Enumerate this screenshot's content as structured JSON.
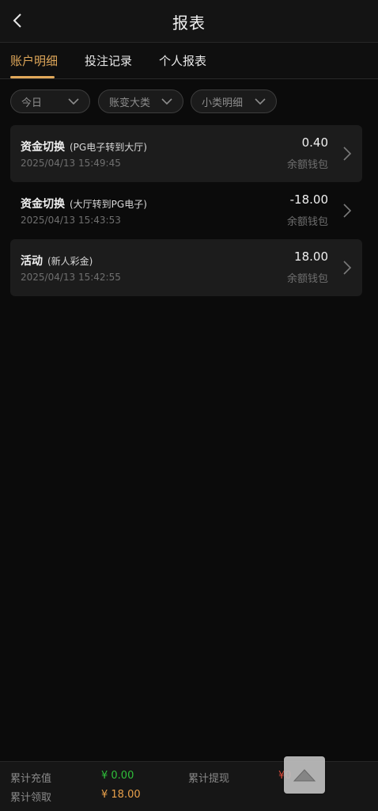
{
  "header": {
    "title": "报表",
    "back_icon": "chevron-left-icon"
  },
  "tabs": [
    {
      "label": "账户明细",
      "active": true
    },
    {
      "label": "投注记录",
      "active": false
    },
    {
      "label": "个人报表",
      "active": false
    }
  ],
  "filters": [
    {
      "label": "今日"
    },
    {
      "label": "账变大类"
    },
    {
      "label": "小类明细"
    }
  ],
  "records": [
    {
      "title": "资金切换",
      "subtitle": "(PG电子转到大厅)",
      "time": "2025/04/13 15:49:45",
      "amount": "0.40",
      "wallet": "余额钱包"
    },
    {
      "title": "资金切换",
      "subtitle": "(大厅转到PG电子)",
      "time": "2025/04/13 15:43:53",
      "amount": "-18.00",
      "wallet": "余额钱包"
    },
    {
      "title": "活动",
      "subtitle": "(新人彩金)",
      "time": "2025/04/13 15:42:55",
      "amount": "18.00",
      "wallet": "余额钱包"
    }
  ],
  "footer": {
    "recharge_label": "累计充值",
    "recharge_value": "¥ 0.00",
    "withdraw_label": "累计提现",
    "withdraw_value": "¥0",
    "claim_label": "累计领取",
    "claim_value": "¥ 18.00"
  },
  "colors": {
    "accent": "#e0a85a",
    "green": "#2fbf3a",
    "orange": "#e8a04a",
    "red": "#d94a3a"
  }
}
